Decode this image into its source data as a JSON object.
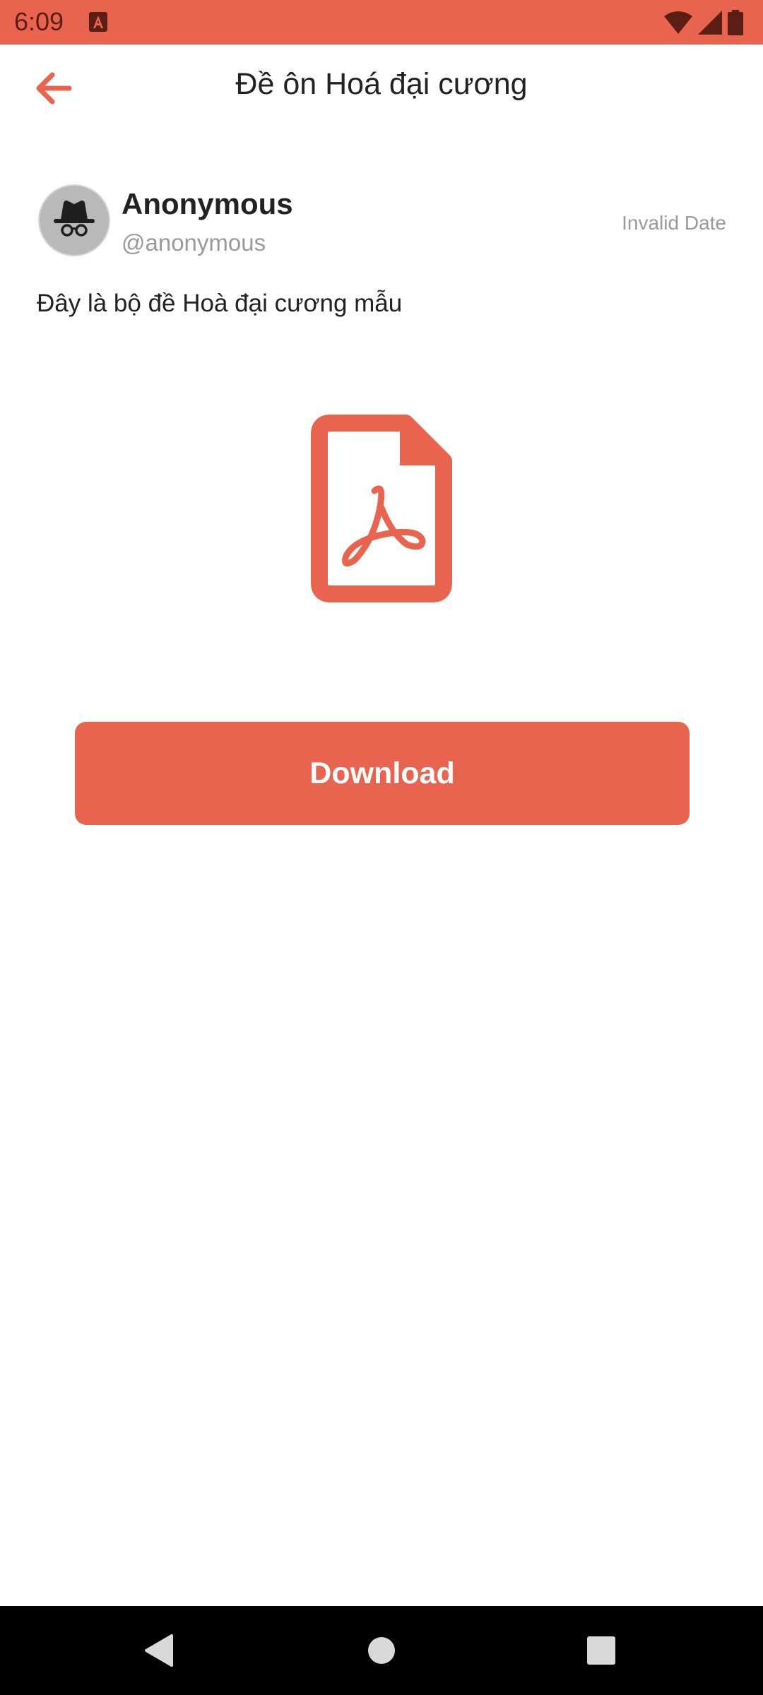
{
  "status_bar": {
    "time": "6:09",
    "icons": [
      "app-notification-icon",
      "wifi-icon",
      "cellular-signal-icon",
      "battery-icon"
    ]
  },
  "app_bar": {
    "back_icon": "arrow-back-icon",
    "title": "Đề ôn Hoá đại cương"
  },
  "post": {
    "author_name": "Anonymous",
    "author_handle": "@anonymous",
    "date": "Invalid Date",
    "description": "Đây là bộ đề Hoà đại cương mẫu",
    "avatar_icon": "incognito-icon",
    "attachment_icon": "pdf-file-icon"
  },
  "actions": {
    "download_label": "Download"
  },
  "nav_bar": {
    "icons": [
      "nav-back-icon",
      "nav-home-icon",
      "nav-recents-icon"
    ]
  },
  "colors": {
    "accent": "#e8644f",
    "text_primary": "#222222",
    "text_secondary": "#9a9a9a",
    "nav_background": "#000000"
  }
}
